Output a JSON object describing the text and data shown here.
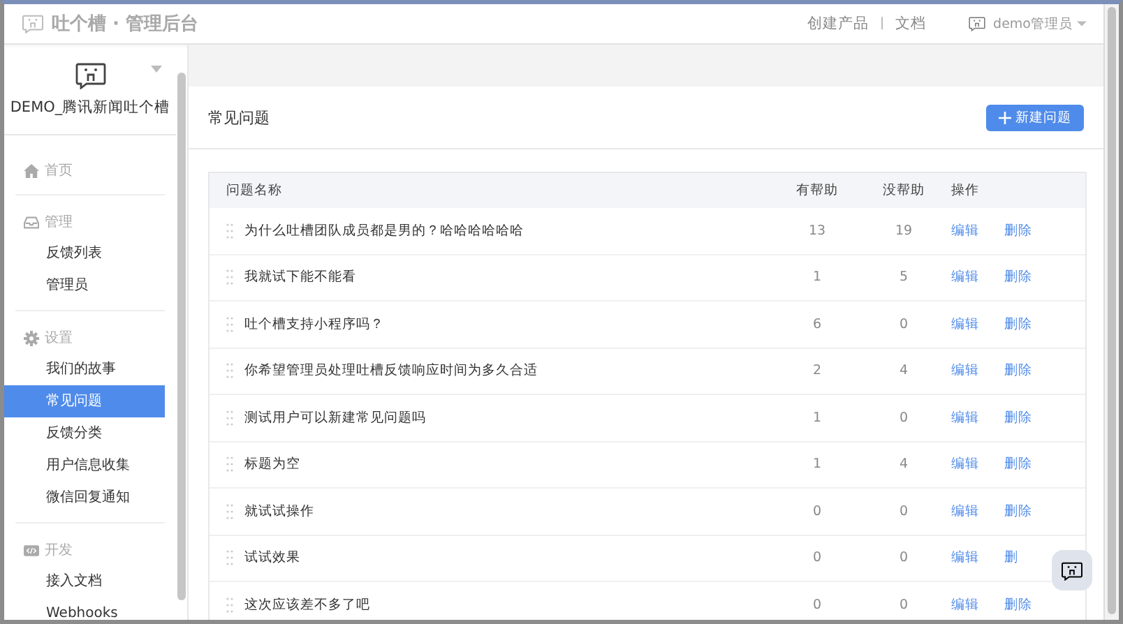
{
  "top_bar": {
    "app_title": "吐个槽 · 管理后台",
    "links": [
      "创建产品",
      "文档"
    ],
    "separator": "|",
    "user": "demo管理员"
  },
  "sidebar": {
    "product_name": "DEMO_腾讯新闻吐个槽",
    "groups": [
      {
        "kind": "home",
        "label": "首页"
      },
      {
        "kind": "inbox",
        "label": "管理",
        "items": [
          {
            "label": "反馈列表",
            "selected": false
          },
          {
            "label": "管理员",
            "selected": false
          }
        ]
      },
      {
        "kind": "gear",
        "label": "设置",
        "items": [
          {
            "label": "我们的故事",
            "selected": false
          },
          {
            "label": "常见问题",
            "selected": true
          },
          {
            "label": "反馈分类",
            "selected": false
          },
          {
            "label": "用户信息收集",
            "selected": false
          },
          {
            "label": "微信回复通知",
            "selected": false
          }
        ]
      },
      {
        "kind": "code",
        "label": "开发",
        "items": [
          {
            "label": "接入文档",
            "selected": false
          },
          {
            "label": "Webhooks",
            "selected": false
          }
        ]
      }
    ]
  },
  "page": {
    "title": "常见问题",
    "new_button": "新建问题",
    "table": {
      "columns": [
        "问题名称",
        "有帮助",
        "没帮助",
        "操作"
      ],
      "rows": [
        {
          "name": "为什么吐槽团队成员都是男的？哈哈哈哈哈哈",
          "helpful": "13",
          "not_helpful": "19",
          "edit": "编辑",
          "delete": "删除"
        },
        {
          "name": "我就试下能不能看",
          "helpful": "1",
          "not_helpful": "5",
          "edit": "编辑",
          "delete": "删除"
        },
        {
          "name": "吐个槽支持小程序吗？",
          "helpful": "6",
          "not_helpful": "0",
          "edit": "编辑",
          "delete": "删除"
        },
        {
          "name": "你希望管理员处理吐槽反馈响应时间为多久合适",
          "helpful": "2",
          "not_helpful": "4",
          "edit": "编辑",
          "delete": "删除"
        },
        {
          "name": "测试用户可以新建常见问题吗",
          "helpful": "1",
          "not_helpful": "0",
          "edit": "编辑",
          "delete": "删除"
        },
        {
          "name": "标题为空",
          "helpful": "1",
          "not_helpful": "4",
          "edit": "编辑",
          "delete": "删除"
        },
        {
          "name": "就试试操作",
          "helpful": "0",
          "not_helpful": "0",
          "edit": "编辑",
          "delete": "删除"
        },
        {
          "name": "试试效果",
          "helpful": "0",
          "not_helpful": "0",
          "edit": "编辑",
          "delete": "删"
        },
        {
          "name": "这次应该差不多了吧",
          "helpful": "0",
          "not_helpful": "0",
          "edit": "编辑",
          "delete": "删除"
        }
      ]
    }
  }
}
